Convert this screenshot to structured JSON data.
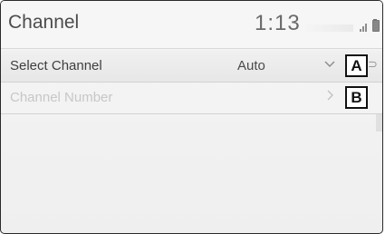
{
  "header": {
    "title": "Channel",
    "clock": "1:13",
    "status_icons": [
      "signal-icon",
      "battery-icon",
      "bluetooth-icon"
    ]
  },
  "rows": [
    {
      "label": "Select Channel",
      "value": "Auto",
      "control_icon": "chevron-down-icon",
      "callout": "A"
    },
    {
      "label": "Channel Number",
      "value": "",
      "control_icon": "chevron-right-icon",
      "callout": "B"
    }
  ],
  "colors": {
    "screen_bg": "#f4f4f4",
    "disabled_text": "#c7c7c7",
    "border": "#2a2a2a"
  }
}
